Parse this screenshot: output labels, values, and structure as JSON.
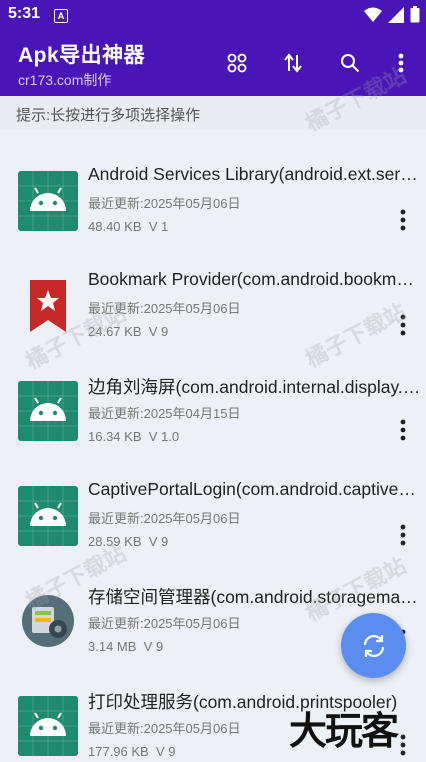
{
  "status_bar": {
    "time": "5:31",
    "notification_icon": "A"
  },
  "app_bar": {
    "title": "Apk导出神器",
    "subtitle": "cr173.com制作",
    "actions": [
      "grid-icon",
      "sort-icon",
      "search-icon",
      "more-vert-icon"
    ]
  },
  "hint": "提示:长按进行多项选择操作",
  "apps": [
    {
      "name": "Android Services Library(android.ext.services)",
      "date": "最近更新:2025年05月06日",
      "size": "48.40 KB",
      "version": "V 1",
      "icon": "android-icon"
    },
    {
      "name": "Bookmark Provider(com.android.bookmarkprovider)",
      "date": "最近更新:2025年05月06日",
      "size": "24.67 KB",
      "version": "V 9",
      "icon": "bookmark-icon"
    },
    {
      "name": "边角刘海屏(com.android.internal.display.cutout)",
      "date": "最近更新:2025年04月15日",
      "size": "16.34 KB",
      "version": "V 1.0",
      "icon": "android-icon"
    },
    {
      "name": "CaptivePortalLogin(com.android.captiveportallogin)",
      "date": "最近更新:2025年05月06日",
      "size": "28.59 KB",
      "version": "V 9",
      "icon": "android-icon"
    },
    {
      "name": "存储空间管理器(com.android.storagemanager)",
      "date": "最近更新:2025年05月06日",
      "size": "3.14 MB",
      "version": "V 9",
      "icon": "storage-manager-icon"
    },
    {
      "name": "打印处理服务(com.android.printspooler)",
      "date": "最近更新:2025年05月06日",
      "size": "177.96 KB",
      "version": "V 9",
      "icon": "android-icon"
    }
  ],
  "fab_icon": "refresh-icon",
  "watermark": "橘子下载站",
  "brand_watermark": "大玩客",
  "colors": {
    "app_bar": "#4a15b7",
    "fab": "#5b8def",
    "android_icon_bg": "#1e8a6e"
  }
}
